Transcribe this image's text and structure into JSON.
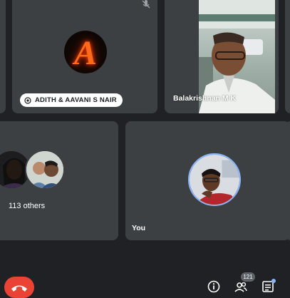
{
  "participants": {
    "adith": {
      "name": "ADITH & AAVANI S NAIR",
      "avatar_letter": "A",
      "mic": "muted"
    },
    "balakrishnan": {
      "name": "Balakrishnan M K"
    },
    "others": {
      "label": "113 others"
    },
    "self": {
      "label": "You"
    }
  },
  "controls": {
    "people_count": "121",
    "icons": [
      "end-call-icon",
      "info-icon",
      "people-icon",
      "chat-icon"
    ]
  },
  "colors": {
    "tile": "#3c4043",
    "background": "#202124",
    "end_call": "#ea4335",
    "accent": "#8ab4f8"
  }
}
